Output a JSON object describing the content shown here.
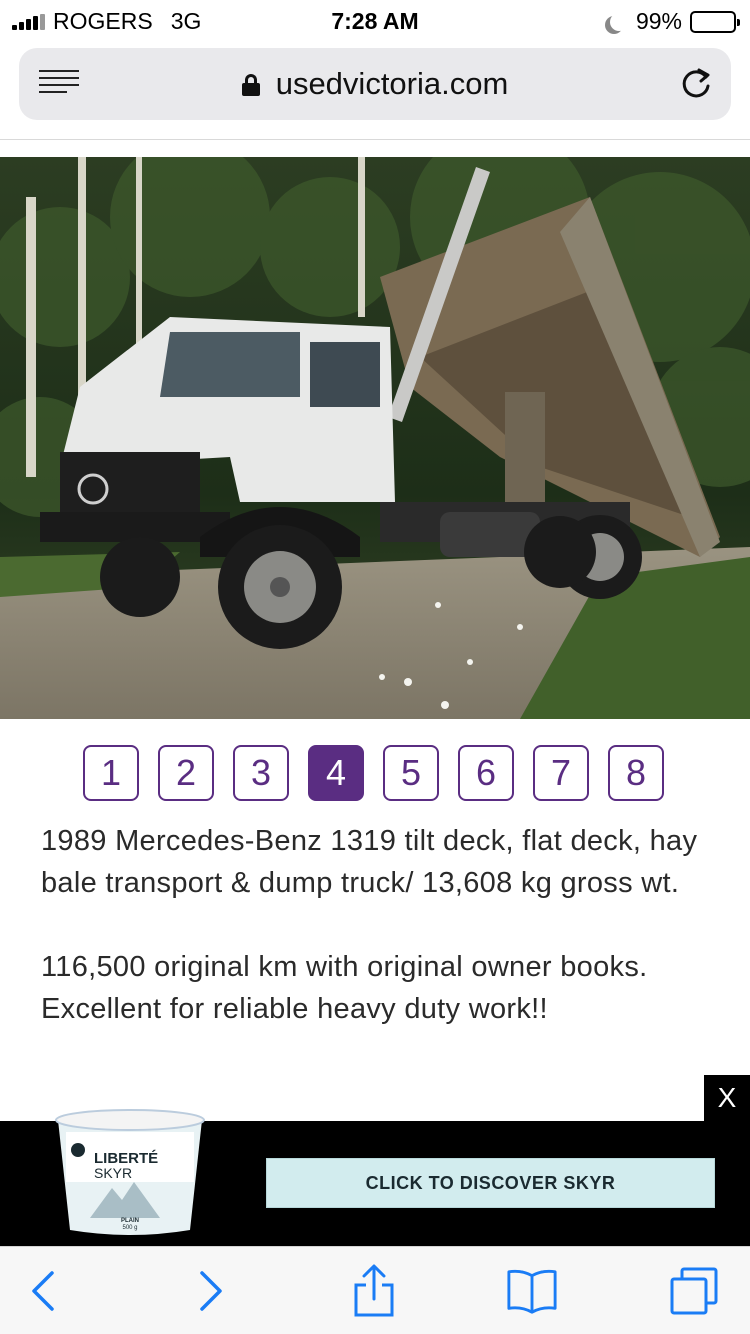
{
  "status_bar": {
    "carrier": "ROGERS",
    "network": "3G",
    "time": "7:28 AM",
    "battery": "99%",
    "battery_level": 0.99
  },
  "browser": {
    "url": "usedvictoria.com"
  },
  "listing": {
    "photo_icon": "dump-truck-photo",
    "pages": [
      "1",
      "2",
      "3",
      "4",
      "5",
      "6",
      "7",
      "8"
    ],
    "active_page": "4",
    "description_1": "1989 Mercedes-Benz 1319 tilt deck, flat deck, hay bale transport & dump truck/ 13,608 kg gross wt.",
    "description_2": "116,500 original km with original owner books. Excellent for reliable heavy duty work!!"
  },
  "ad": {
    "close_label": "X",
    "cta_label": "CLICK TO DISCOVER SKYR",
    "product_brand": "LIBERTÉ",
    "product_name": "SKYR",
    "product_flavor": "PLAIN",
    "product_size": "500 g"
  },
  "colors": {
    "accent": "#5a2d82",
    "ios_blue": "#1a7cf5",
    "cta_bg": "#d2ecee"
  }
}
